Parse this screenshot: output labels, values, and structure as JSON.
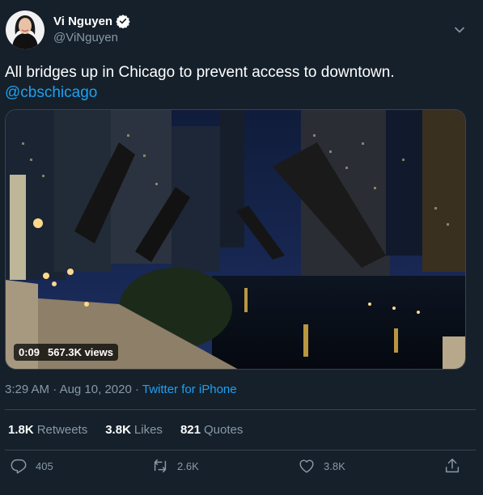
{
  "author": {
    "name": "Vi Nguyen",
    "handle": "@ViNguyen"
  },
  "tweet": {
    "text": "All bridges up in Chicago to prevent access to downtown.",
    "mention": "@cbschicago"
  },
  "video": {
    "duration": "0:09",
    "views": "567.3K views"
  },
  "meta": {
    "time": "3:29 AM",
    "separator": " · ",
    "date": "Aug 10, 2020",
    "source": "Twitter for iPhone"
  },
  "stats": {
    "retweets_count": "1.8K",
    "retweets_label": "Retweets",
    "likes_count": "3.8K",
    "likes_label": "Likes",
    "quotes_count": "821",
    "quotes_label": "Quotes"
  },
  "actions": {
    "reply_count": "405",
    "retweet_count": "2.6K",
    "like_count": "3.8K"
  },
  "icons": {
    "verified": "verified-badge-icon",
    "caret": "chevron-down-icon",
    "reply": "reply-icon",
    "retweet": "retweet-icon",
    "like": "heart-icon",
    "share": "share-icon"
  },
  "colors": {
    "background": "#15202b",
    "accent": "#1da1f2",
    "muted": "#8899a6",
    "divider": "#38444d"
  }
}
